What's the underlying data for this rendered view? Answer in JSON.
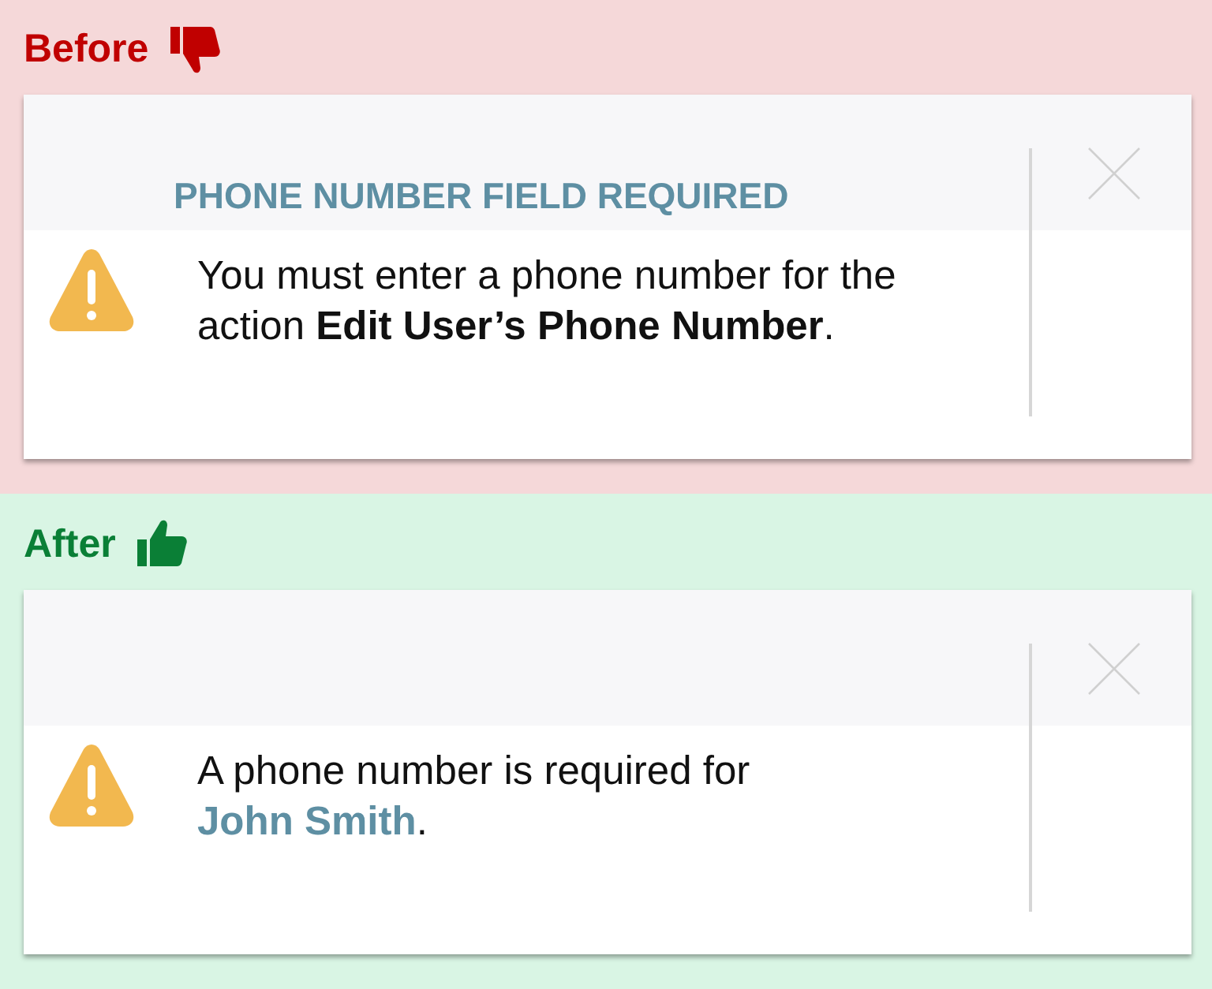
{
  "panels": [
    {
      "heading": "Before",
      "kind": "negative",
      "alert": {
        "title": "PHONE NUMBER FIELD REQUIRED",
        "message": [
          {
            "kind": "text",
            "text": "You must enter a phone number for the action **Edit User’s Phone Number**."
          }
        ]
      }
    },
    {
      "heading": "After",
      "kind": "positive",
      "alert": {
        "message": [
          {
            "kind": "text",
            "text": "A phone number is required for "
          },
          {
            "kind": "link",
            "text": "John Smith"
          },
          {
            "kind": "text",
            "text": "."
          }
        ]
      }
    }
  ]
}
